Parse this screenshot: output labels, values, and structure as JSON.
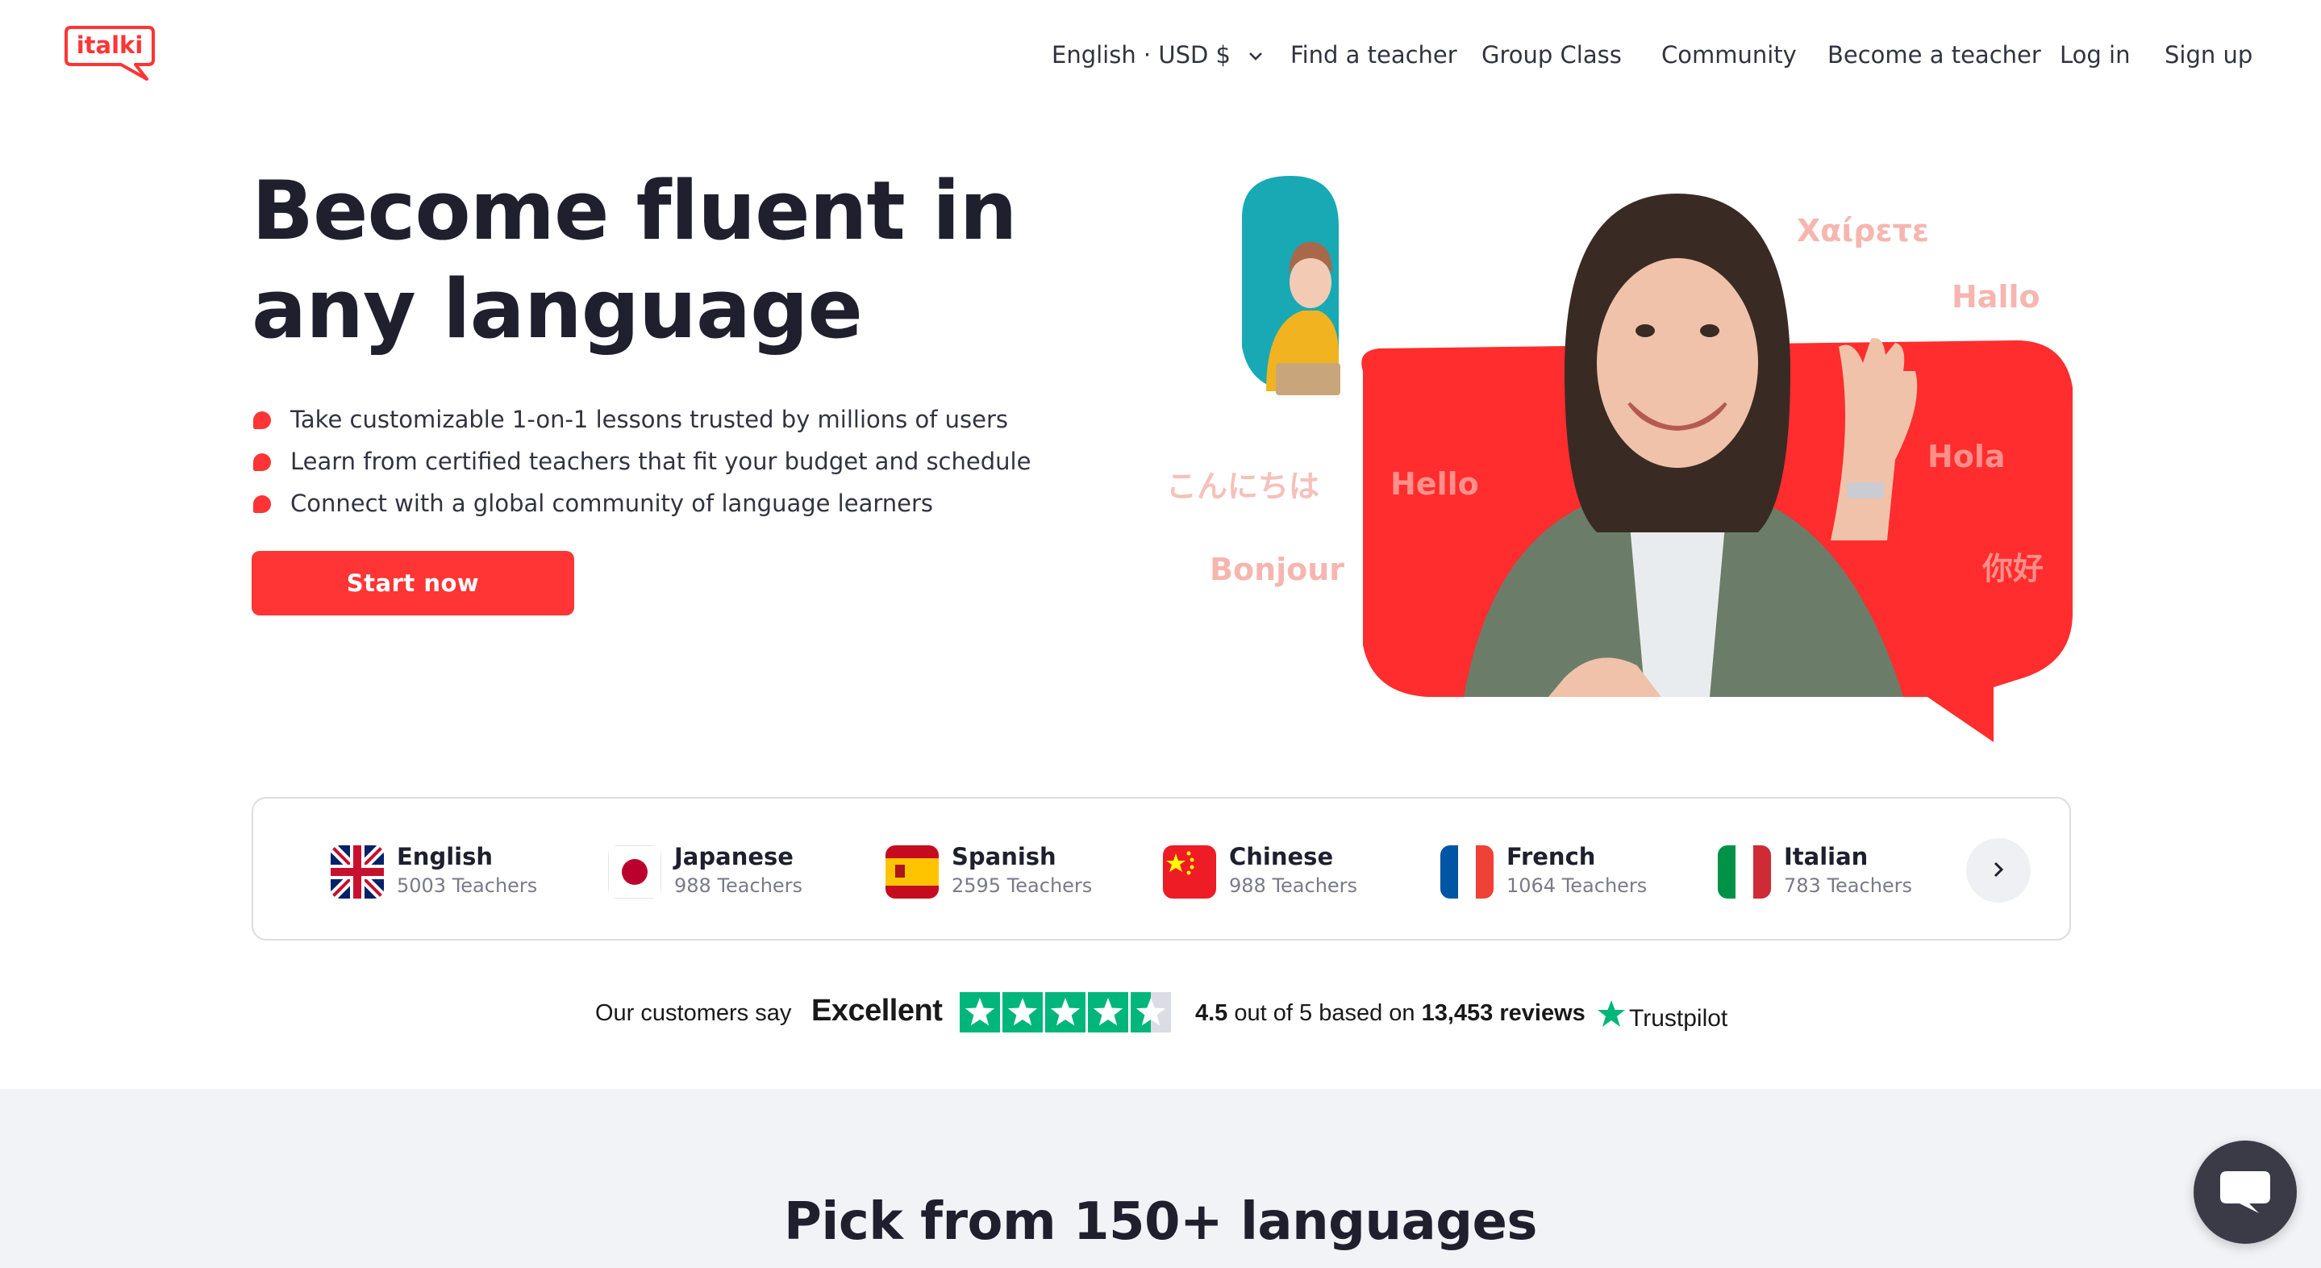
{
  "brand": {
    "logo_text": "italki",
    "accent_color": "#ff3535"
  },
  "nav": {
    "locale": "English · USD $",
    "items": [
      "Find a teacher",
      "Group Class",
      "Community",
      "Become a teacher",
      "Log in",
      "Sign up"
    ]
  },
  "hero": {
    "title": "Become fluent in any language",
    "bullets": [
      "Take customizable 1-on-1 lessons trusted by millions of users",
      "Learn from certified teachers that fit your budget and schedule",
      "Connect with a global community of language learners"
    ],
    "cta_label": "Start now",
    "greetings": [
      "Χαίρετε",
      "Hallo",
      "Hola",
      "你好",
      "こんにちは",
      "Hello",
      "Bonjour"
    ]
  },
  "languages": [
    {
      "name": "English",
      "count": "5003 Teachers",
      "flag": "uk-flag"
    },
    {
      "name": "Japanese",
      "count": "988 Teachers",
      "flag": "japan-flag"
    },
    {
      "name": "Spanish",
      "count": "2595 Teachers",
      "flag": "spain-flag"
    },
    {
      "name": "Chinese",
      "count": "988 Teachers",
      "flag": "china-flag"
    },
    {
      "name": "French",
      "count": "1064 Teachers",
      "flag": "france-flag"
    },
    {
      "name": "Italian",
      "count": "783 Teachers",
      "flag": "italy-flag"
    }
  ],
  "trustpilot": {
    "customers_say": "Our customers say",
    "verdict": "Excellent",
    "rating_prefix": "4.5",
    "rating_mid": "out of 5 based on",
    "review_count": "13,453 reviews",
    "brand": "Trustpilot",
    "stars": 4.5,
    "star_color": "#00b67a"
  },
  "section2": {
    "title": "Pick from 150+ languages"
  },
  "chat": {
    "icon": "chat-bubble-icon"
  }
}
